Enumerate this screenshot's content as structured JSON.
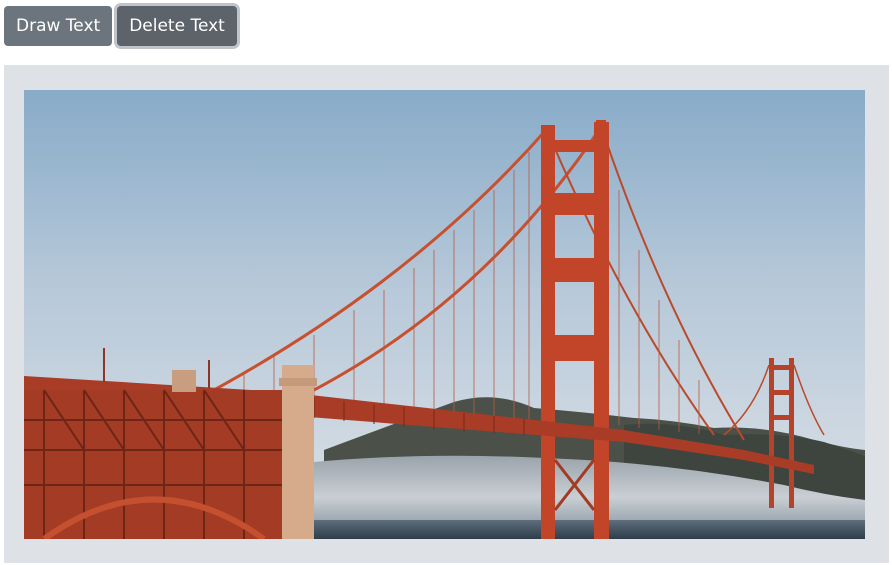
{
  "toolbar": {
    "draw_label": "Draw Text",
    "delete_label": "Delete Text"
  },
  "canvas": {
    "image_subject": "golden-gate-bridge-photo"
  },
  "colors": {
    "button_bg": "#6c757d",
    "panel_bg": "#dee2e6",
    "bridge": "#c0452a"
  }
}
